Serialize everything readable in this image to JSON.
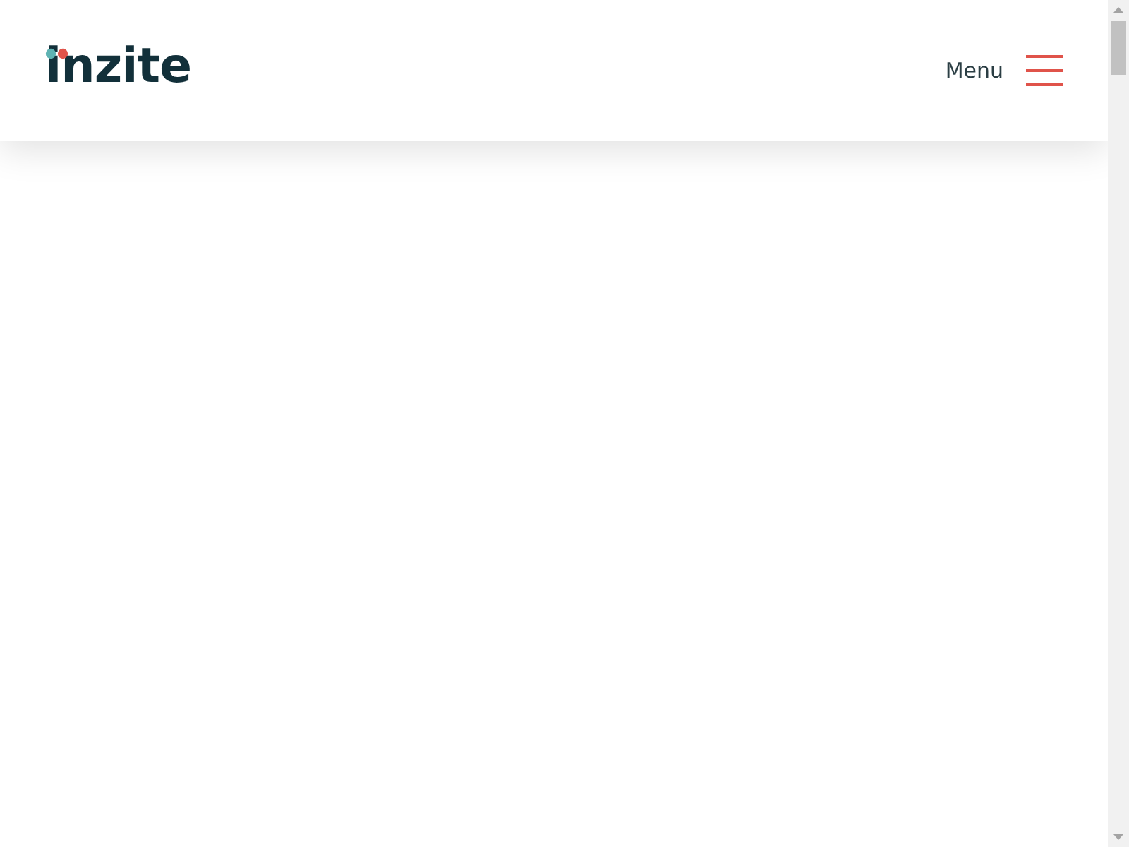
{
  "header": {
    "logo": "inzite",
    "menu_label": "Menu"
  }
}
